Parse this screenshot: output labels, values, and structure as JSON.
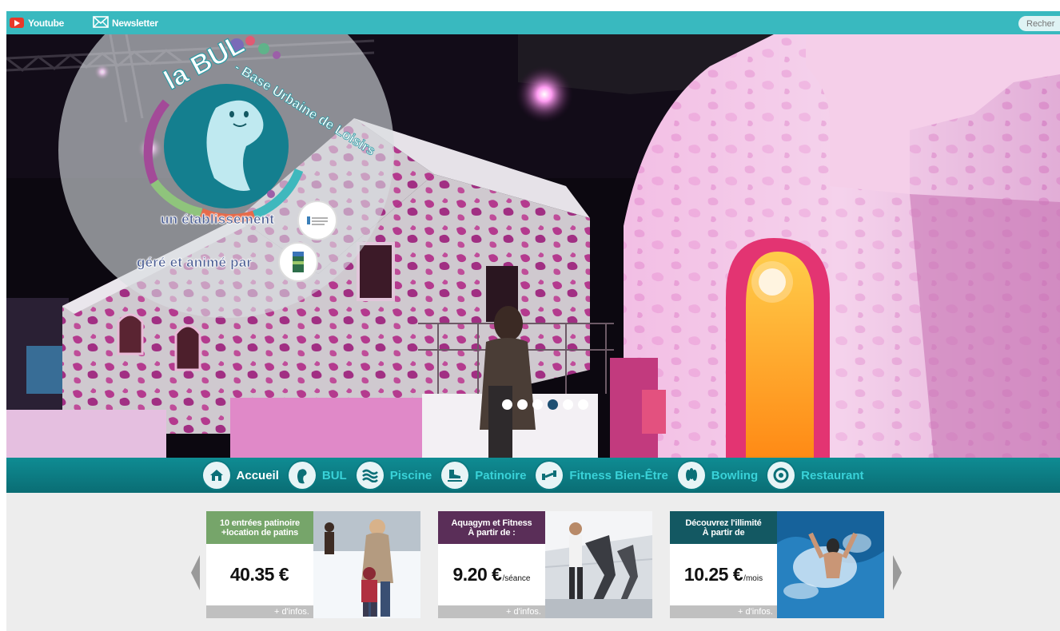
{
  "topbar": {
    "youtube_label": "Youtube",
    "newsletter_label": "Newsletter",
    "search_placeholder": "Recher"
  },
  "hero": {
    "logo_text": "la BUL - Base Urbaine de Loisirs",
    "line1": "un établissement",
    "line2": "géré et animé par",
    "slides_total": 6,
    "slide_active": 4
  },
  "nav": {
    "items": [
      {
        "label": "Accueil",
        "icon": "house-icon",
        "active": true
      },
      {
        "label": "BUL",
        "icon": "mascot-icon",
        "active": false
      },
      {
        "label": "Piscine",
        "icon": "waves-icon",
        "active": false
      },
      {
        "label": "Patinoire",
        "icon": "skate-icon",
        "active": false
      },
      {
        "label": "Fitness Bien-Être",
        "icon": "fitness-icon",
        "active": false
      },
      {
        "label": "Bowling",
        "icon": "bowling-pins-icon",
        "active": false
      },
      {
        "label": "Restaurant",
        "icon": "plate-icon",
        "active": false
      }
    ]
  },
  "offers": [
    {
      "head_line1": "10 entrées patinoire",
      "head_line2": "+location de patins",
      "price": "40.35 €",
      "unit": "",
      "more": "+ d'infos.",
      "head_color": "#76a56a"
    },
    {
      "head_line1": "Aquagym et Fitness",
      "head_line2": "À partir de :",
      "price": "9.20 €",
      "unit": "/séance",
      "more": "+ d'infos.",
      "head_color": "#5a2e58"
    },
    {
      "head_line1": "Découvrez l'illimité",
      "head_line2": "À partir de",
      "price": "10.25 €",
      "unit": "/mois",
      "more": "+ d'infos.",
      "head_color": "#135862"
    }
  ],
  "colors": {
    "topbar": "#39b9bf",
    "nav": "#0a7d84",
    "nav_label": "#39d2d8",
    "dot_active": "#1e4f72"
  }
}
